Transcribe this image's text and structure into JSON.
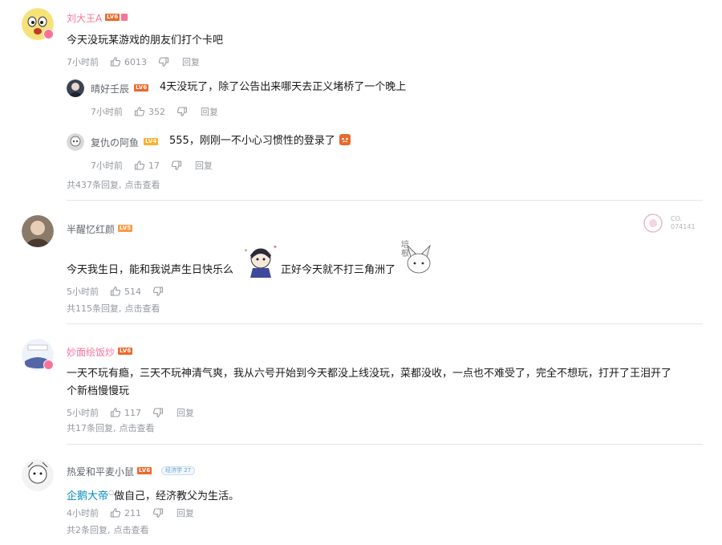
{
  "colors": {
    "accent_pink": "#fb7299",
    "link_blue": "#008ac5",
    "meta_gray": "#9499a0",
    "text": "#18191c",
    "level_red": "#ee672a",
    "level_orange": "#ff9a45"
  },
  "comments": [
    {
      "username": "刘大王A",
      "level": "LV6",
      "text": "今天没玩某游戏的朋友们打个卡吧",
      "time": "7小时前",
      "likes": "6013",
      "reply_label": "回复",
      "sub_replies": [
        {
          "username": "晴好壬辰",
          "level": "LV6",
          "text": "4天没玩了，除了公告出来哪天去正义堵桥了一个晚上",
          "time": "7小时前",
          "likes": "352",
          "reply_label": "回复"
        },
        {
          "username": "复仇の阿鱼",
          "level": "LV4",
          "text": "555，刚刚一不小心习惯性的登录了",
          "time": "7小时前",
          "likes": "17",
          "reply_label": "回复"
        }
      ],
      "replies_count": "共437条回复,",
      "replies_cta": "点击查看"
    },
    {
      "username": "半醒忆红颜",
      "level": "LV5",
      "text_part1": "今天我生日，能和我说声生日快乐么",
      "text_part2": "正好今天就不打三角洲了",
      "time": "5小时前",
      "likes": "514",
      "replies_count": "共115条回复,",
      "replies_cta": "点击查看",
      "stamp_text_1": "CO.",
      "stamp_text_2": "074141",
      "sticker_text": "培根"
    },
    {
      "username": "妙面绘饭炒",
      "level": "LV6",
      "text_line1": "一天不玩有瘾，三天不玩神清气爽，我从六号开始到今天都没上线没玩，菜都没收，一点也不难受了，完全不想玩，打开了王泪开了",
      "text_line2": "个新档慢慢玩",
      "time": "5小时前",
      "likes": "117",
      "reply_label": "回复",
      "replies_count": "共17条回复,",
      "replies_cta": "点击查看"
    },
    {
      "username": "热爱和平麦小鼠",
      "level": "LV6",
      "badge": "经济学 27",
      "mention": "企鹅大帝",
      "text": "做自己，经济教父为生活。",
      "time": "4小时前",
      "likes": "211",
      "reply_label": "回复",
      "replies_count": "共2条回复,",
      "replies_cta": "点击查看"
    }
  ]
}
